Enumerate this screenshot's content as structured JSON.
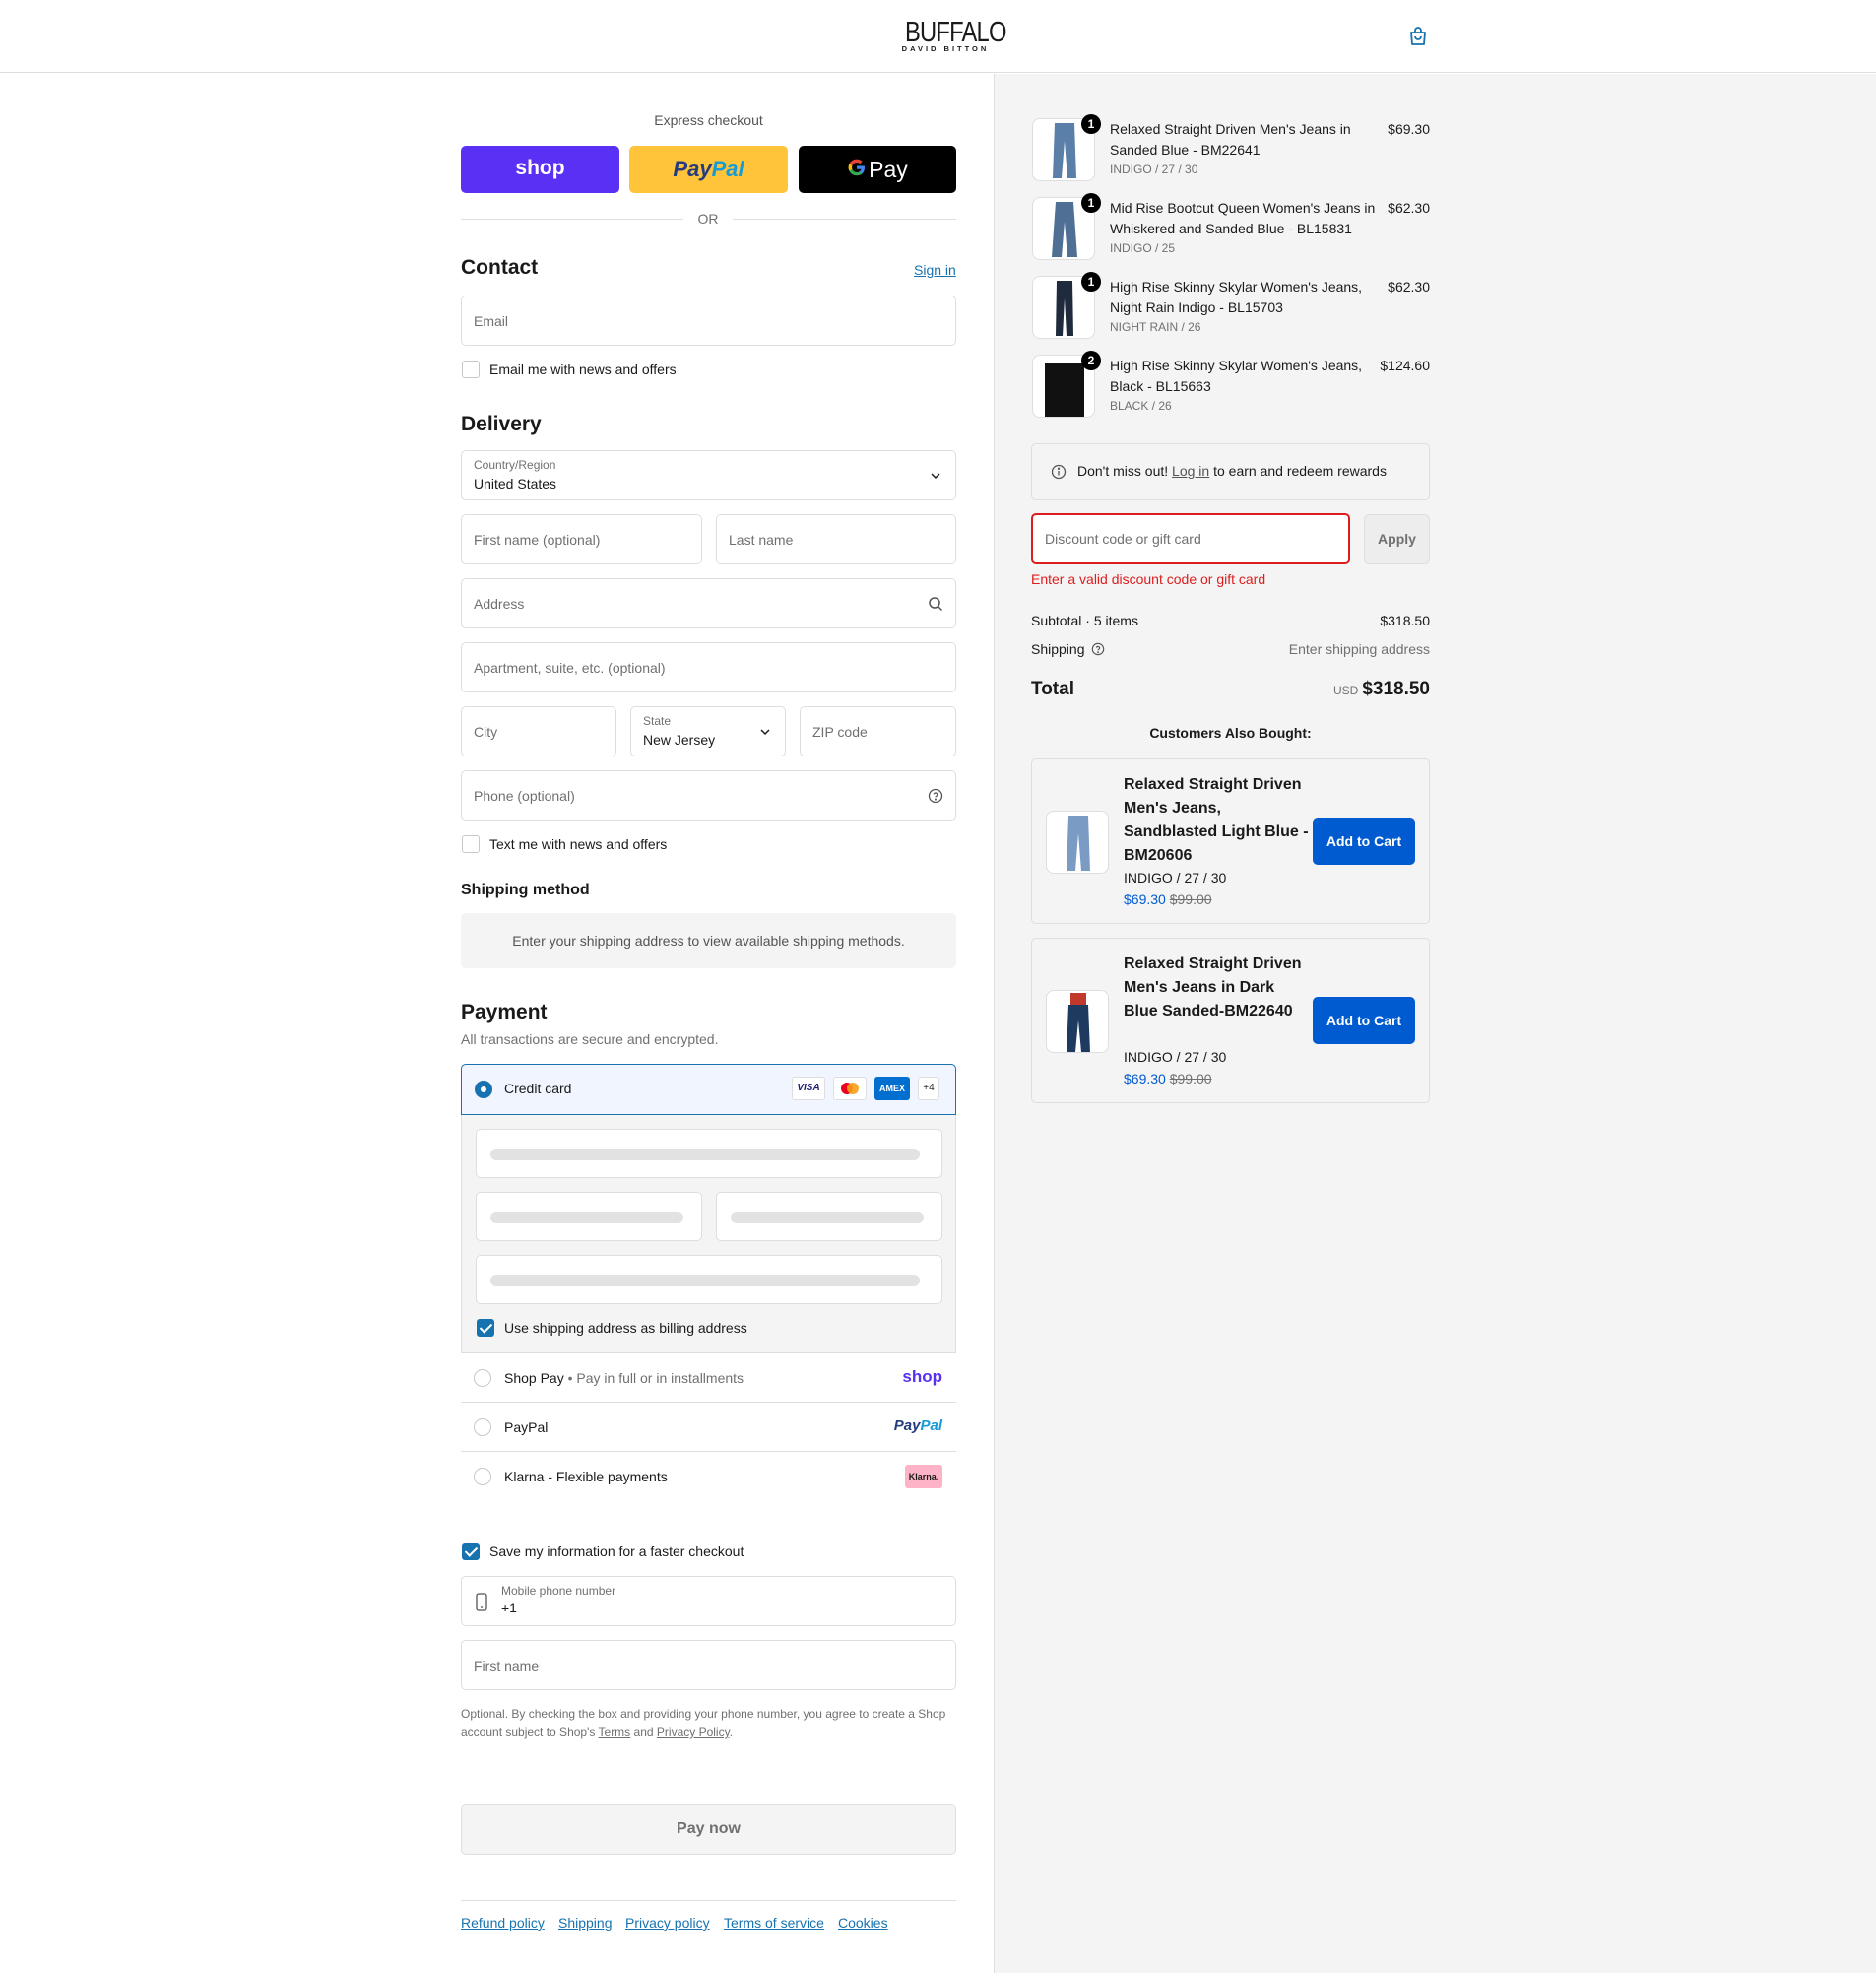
{
  "header": {
    "logo_main": "BUFFALO",
    "logo_sub": "DAVID BITTON"
  },
  "express": {
    "title": "Express checkout",
    "shop_label": "shop",
    "paypal_label": "PayPal",
    "gpay_label": "Pay",
    "or": "OR",
    "colors": {
      "shop": "#5a31f4",
      "paypal": "#ffc439",
      "gpay": "#000000"
    }
  },
  "contact": {
    "title": "Contact",
    "sign_in": "Sign in",
    "email_placeholder": "Email",
    "news_label": "Email me with news and offers",
    "news_checked": false
  },
  "delivery": {
    "title": "Delivery",
    "country_label": "Country/Region",
    "country_value": "United States",
    "first_name_placeholder": "First name (optional)",
    "last_name_placeholder": "Last name",
    "address_placeholder": "Address",
    "apartment_placeholder": "Apartment, suite, etc. (optional)",
    "city_placeholder": "City",
    "state_label": "State",
    "state_value": "New Jersey",
    "zip_placeholder": "ZIP code",
    "phone_placeholder": "Phone (optional)",
    "text_label": "Text me with news and offers",
    "text_checked": false
  },
  "shipping_method": {
    "title": "Shipping method",
    "notice": "Enter your shipping address to view available shipping methods."
  },
  "payment": {
    "title": "Payment",
    "subtitle": "All transactions are secure and encrypted.",
    "credit_card_label": "Credit card",
    "card_brands": [
      "VISA",
      "Mastercard",
      "AMEX",
      "+4"
    ],
    "billing_label": "Use shipping address as billing address",
    "billing_checked": true,
    "shop_pay_label": "Shop Pay",
    "shop_pay_sub": "Pay in full or in installments",
    "shop_pay_logo": "shop",
    "paypal_label": "PayPal",
    "paypal_logo": "PayPal",
    "klarna_label": "Klarna - Flexible payments",
    "klarna_logo": "Klarna.",
    "accent": "#1773b0"
  },
  "save_info": {
    "label": "Save my information for a faster checkout",
    "checked": true,
    "mobile_label": "Mobile phone number",
    "mobile_value": "+1",
    "first_name_placeholder": "First name",
    "legal_1": "Optional. By checking the box and providing your phone number, you agree to create a Shop",
    "legal_2": "account subject to Shop's",
    "terms": "Terms",
    "and": "and",
    "privacy": "Privacy Policy",
    "period": "."
  },
  "pay_now": "Pay now",
  "footer": {
    "links": [
      "Refund policy",
      "Shipping",
      "Privacy policy",
      "Terms of service",
      "Cookies"
    ]
  },
  "order": {
    "items": [
      {
        "qty": "1",
        "name": "Relaxed Straight Driven Men's Jeans in Sanded Blue - BM22641",
        "variant": "INDIGO / 27 / 30",
        "price": "$69.30"
      },
      {
        "qty": "1",
        "name": "Mid Rise Bootcut Queen Women's Jeans in Whiskered and Sanded Blue - BL15831",
        "variant": "INDIGO / 25",
        "price": "$62.30"
      },
      {
        "qty": "1",
        "name": "High Rise Skinny Skylar Women's Jeans, Night Rain Indigo - BL15703",
        "variant": "NIGHT RAIN / 26",
        "price": "$62.30"
      },
      {
        "qty": "2",
        "name": "High Rise Skinny Skylar Women's Jeans, Black - BL15663",
        "variant": "BLACK / 26",
        "price": "$124.60"
      }
    ],
    "rewards_pre": "Don't miss out!",
    "rewards_link": "Log in",
    "rewards_post": "to earn and redeem rewards",
    "discount_placeholder": "Discount code or gift card",
    "apply": "Apply",
    "discount_error": "Enter a valid discount code or gift card",
    "subtotal_label": "Subtotal · 5 items",
    "subtotal_value": "$318.50",
    "shipping_label": "Shipping",
    "shipping_value": "Enter shipping address",
    "total_label": "Total",
    "currency": "USD",
    "total_value": "$318.50",
    "error_color": "#dd1d1d"
  },
  "upsell": {
    "title": "Customers Also Bought:",
    "items": [
      {
        "name": "Relaxed Straight Driven Men's Jeans, Sandblasted Light Blue - BM20606",
        "variant": "INDIGO / 27 / 30",
        "price": "$69.30",
        "compare": "$99.00",
        "cta": "Add to Cart"
      },
      {
        "name": "Relaxed Straight Driven Men's Jeans in Dark Blue Sanded-BM22640",
        "variant": "INDIGO / 27 / 30",
        "price": "$69.30",
        "compare": "$99.00",
        "cta": "Add to Cart"
      }
    ],
    "button_color": "#005bd1"
  }
}
